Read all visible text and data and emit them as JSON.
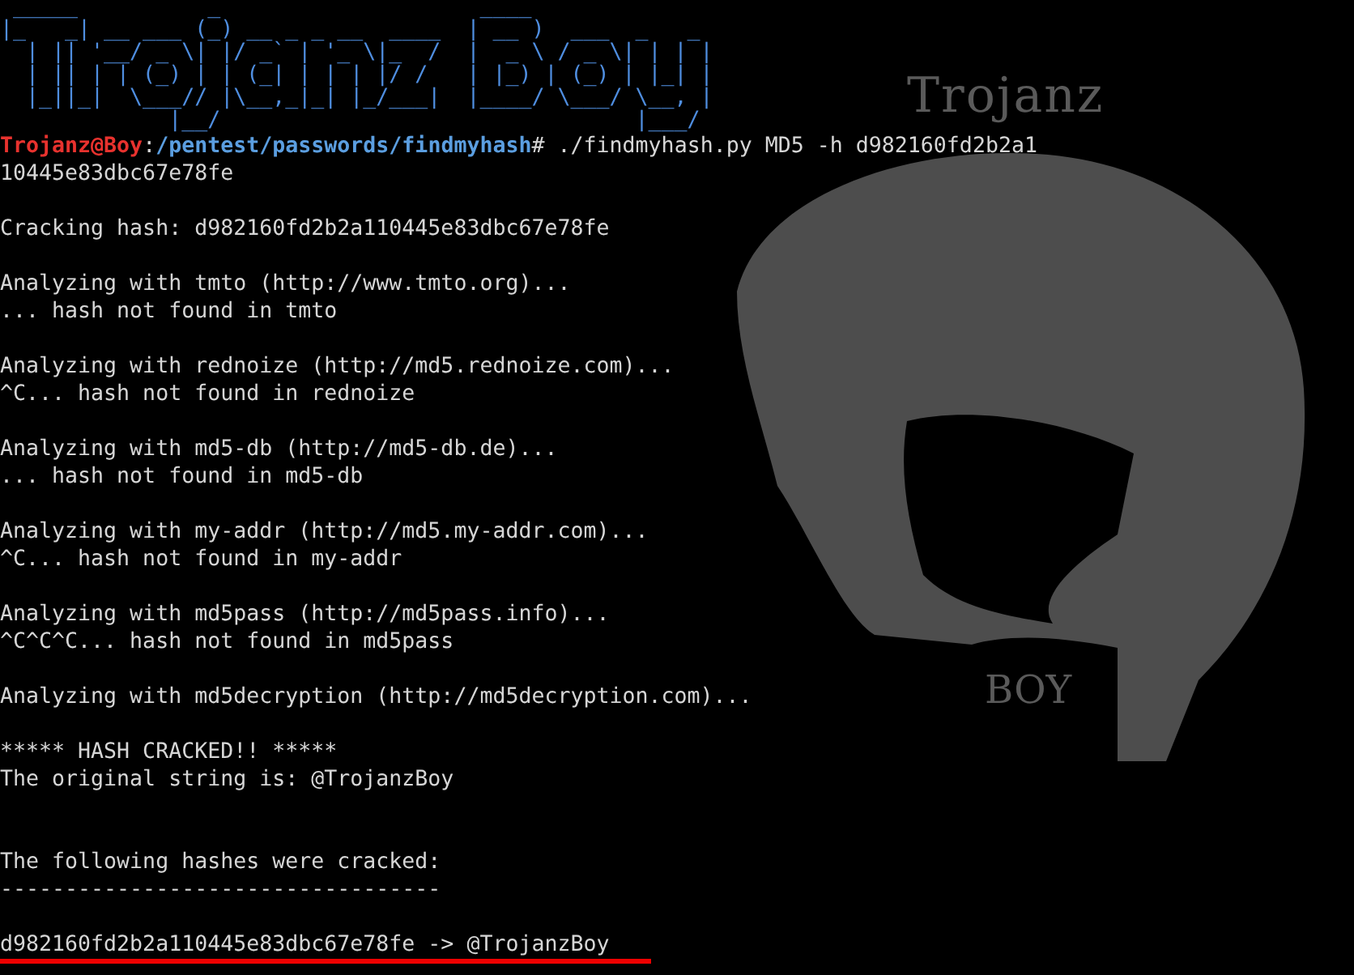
{
  "wallpaper": {
    "title": "Trojanz",
    "subtitle": "BOY"
  },
  "banner": [
    " _____          _                    ____",
    "|_   _| __ ___ (_) __ _ _ __  ____  | __ )  ___  _   _",
    "  | || '__/ _ \\| |/ _` | '_ \\|_  /  |  _ \\ / _ \\| | | |",
    "  | || | | (_) | | (_| | | | |/ /   | |_) | (_) | |_| |",
    "  |_||_|  \\___// |\\__,_|_| |_/___|  |____/ \\___/ \\__, |",
    "             |__/                                |___/"
  ],
  "prompt": {
    "user": "Trojanz@Boy",
    "separator": ":",
    "path": "/pentest/passwords/findmyhash",
    "symbol": "#",
    "command": "./findmyhash.py MD5 -h d982160fd2b2a1"
  },
  "lines": [
    {
      "kind": "text",
      "text": "10445e83dbc67e78fe"
    },
    {
      "kind": "blank"
    },
    {
      "kind": "text",
      "text": "Cracking hash: d982160fd2b2a110445e83dbc67e78fe"
    },
    {
      "kind": "blank"
    },
    {
      "kind": "text",
      "text": "Analyzing with tmto (http://www.tmto.org)..."
    },
    {
      "kind": "text",
      "text": "... hash not found in tmto"
    },
    {
      "kind": "blank"
    },
    {
      "kind": "text",
      "text": "Analyzing with rednoize (http://md5.rednoize.com)..."
    },
    {
      "kind": "text",
      "text": "^C... hash not found in rednoize"
    },
    {
      "kind": "blank"
    },
    {
      "kind": "text",
      "text": "Analyzing with md5-db (http://md5-db.de)..."
    },
    {
      "kind": "text",
      "text": "... hash not found in md5-db"
    },
    {
      "kind": "blank"
    },
    {
      "kind": "text",
      "text": "Analyzing with my-addr (http://md5.my-addr.com)..."
    },
    {
      "kind": "text",
      "text": "^C... hash not found in my-addr"
    },
    {
      "kind": "blank"
    },
    {
      "kind": "text",
      "text": "Analyzing with md5pass (http://md5pass.info)..."
    },
    {
      "kind": "text",
      "text": "^C^C^C... hash not found in md5pass"
    },
    {
      "kind": "blank"
    },
    {
      "kind": "text",
      "text": "Analyzing with md5decryption (http://md5decryption.com)..."
    },
    {
      "kind": "blank"
    },
    {
      "kind": "text",
      "text": "***** HASH CRACKED!! *****"
    },
    {
      "kind": "text",
      "text": "The original string is: @TrojanzBoy"
    },
    {
      "kind": "blank"
    },
    {
      "kind": "blank"
    },
    {
      "kind": "text",
      "text": "The following hashes were cracked:"
    },
    {
      "kind": "text",
      "text": "----------------------------------"
    },
    {
      "kind": "blank"
    },
    {
      "kind": "underlined",
      "text": "d982160fd2b2a110445e83dbc67e78fe -> @TrojanzBoy"
    }
  ]
}
